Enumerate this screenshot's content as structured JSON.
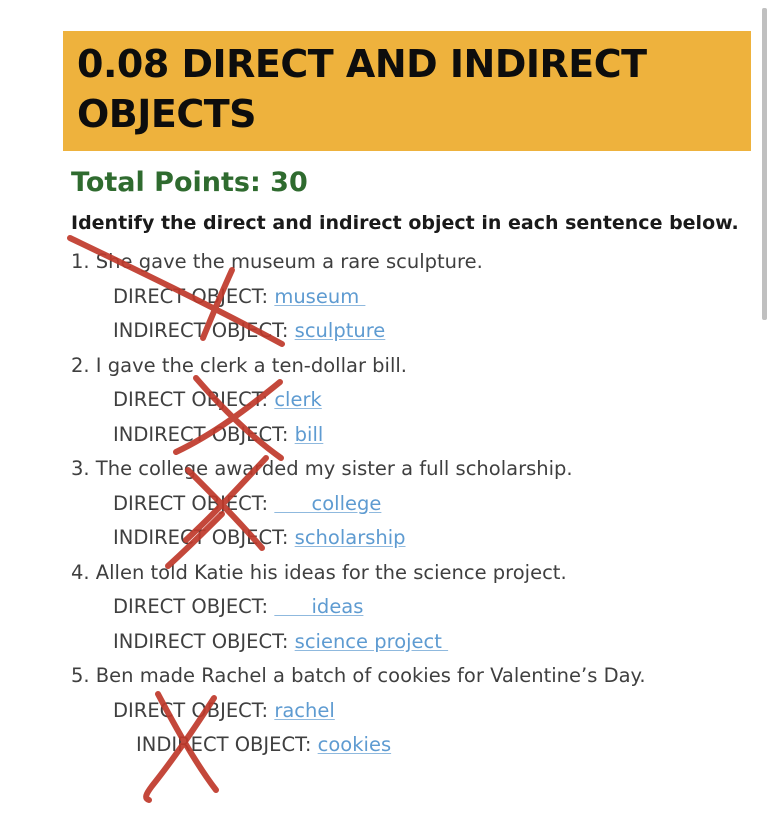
{
  "document": {
    "title": "0.08 DIRECT AND INDIRECT OBJECTS",
    "total_points": "Total Points: 30",
    "instruction": "Identify the direct and indirect object in each sentence below.",
    "banner_color": "#eeb23d",
    "total_points_color": "#2f6b2f",
    "answer_color": "#5e9bd1",
    "ink_color": "#c0392b"
  },
  "questions": [
    {
      "number": "1.",
      "sentence": "1. She gave the museum a rare sculpture.",
      "direct_label": "DIRECT OBJECT: ",
      "direct_value": "museum ",
      "indirect_label": "INDIRECT OBJECT: ",
      "indirect_value": "sculpture"
    },
    {
      "number": "2.",
      "sentence": "2. I gave the clerk a ten-dollar bill.",
      "direct_label": "DIRECT OBJECT: ",
      "direct_value": "clerk",
      "indirect_label": "INDIRECT OBJECT: ",
      "indirect_value": "bill"
    },
    {
      "number": "3.",
      "sentence": "3. The college awarded my sister a full scholarship.",
      "direct_label": "DIRECT OBJECT: ",
      "direct_value": "      college",
      "indirect_label": "INDIRECT OBJECT: ",
      "indirect_value": "scholarship"
    },
    {
      "number": "4.",
      "sentence": "4. Allen told Katie his ideas for the science project.",
      "direct_label": "DIRECT OBJECT: ",
      "direct_value": "      ideas",
      "indirect_label": "INDIRECT OBJECT: ",
      "indirect_value": "science project "
    },
    {
      "number": "5.",
      "sentence": "5. Ben made Rachel a batch of cookies for Valentine’s Day.",
      "direct_label": "DIRECT OBJECT: ",
      "direct_value": "rachel",
      "indirect_label": "INDIRECT OBJECT: ",
      "indirect_value": "cookies"
    }
  ],
  "scrollbar": {
    "thumb_color": "#c0c0c0"
  }
}
